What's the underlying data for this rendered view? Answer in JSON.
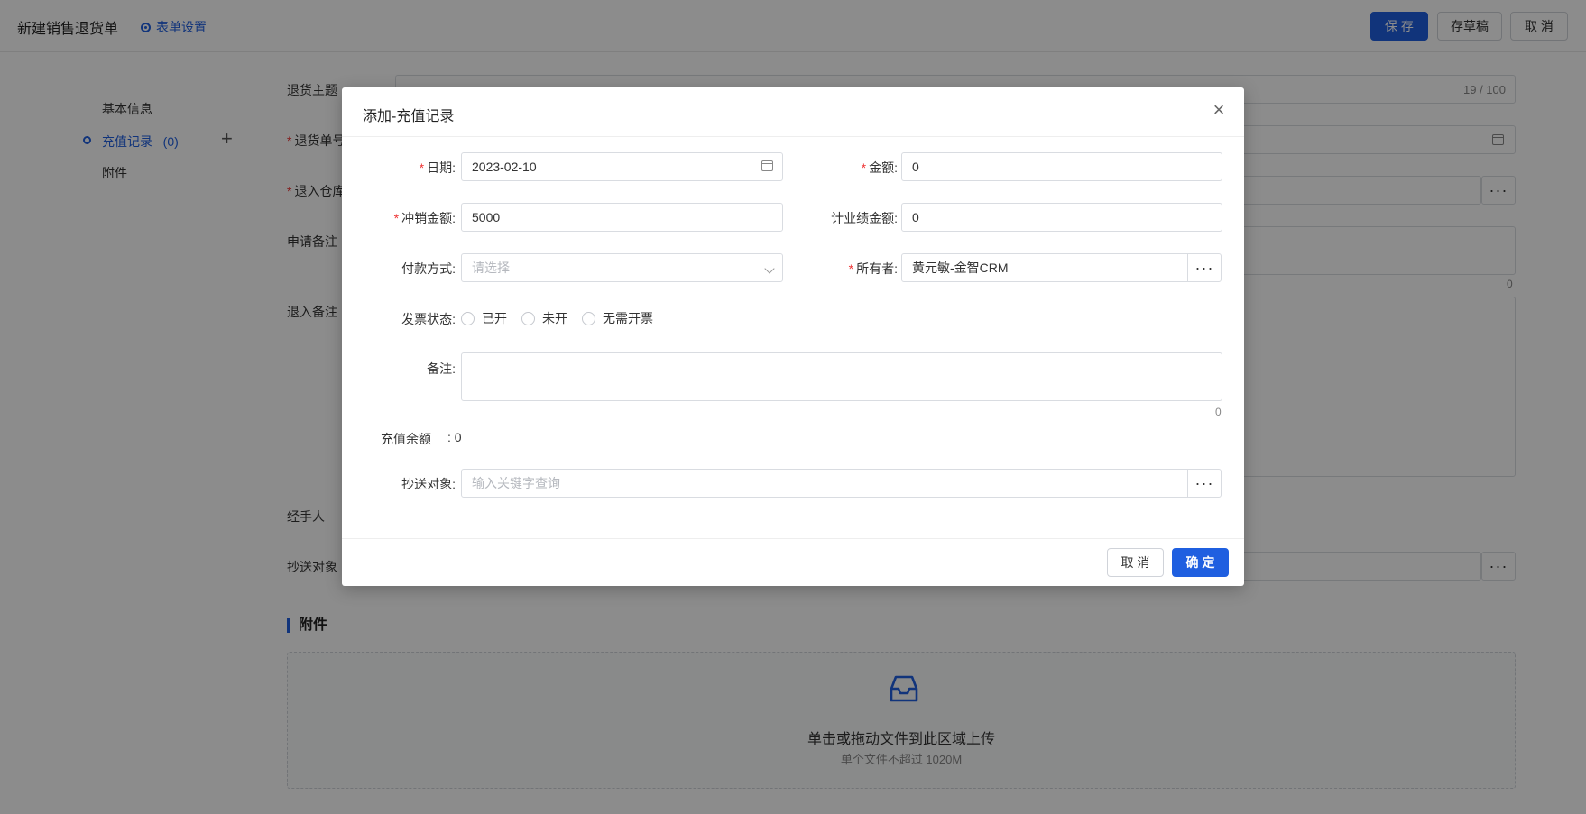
{
  "header": {
    "title": "新建销售退货单",
    "settings_label": "表单设置",
    "save_label": "保 存",
    "draft_label": "存草稿",
    "cancel_label": "取 消"
  },
  "sidebar": {
    "items": [
      {
        "label": "基本信息"
      },
      {
        "label": "充值记录   (0)"
      },
      {
        "label": "附件"
      }
    ]
  },
  "form": {
    "subject_label": "退货主题",
    "subject_counter": "19 / 100",
    "order_no_label": "退货单号",
    "warehouse_label": "退入仓库",
    "apply_note_label": "申请备注",
    "return_note_label": "退入备注",
    "apply_note_counter": "0",
    "handler_label": "经手人",
    "cc_label": "抄送对象",
    "attachment_title": "附件",
    "upload_main": "单击或拖动文件到此区域上传",
    "upload_sub": "单个文件不超过 1020M"
  },
  "modal": {
    "title": "添加-充值记录",
    "date_label": "日期:",
    "date_value": "2023-02-10",
    "amount_label": "金额:",
    "amount_value": "0",
    "writeoff_label": "冲销金额:",
    "writeoff_value": "5000",
    "perf_label": "计业绩金额:",
    "perf_value": "0",
    "payment_label": "付款方式:",
    "payment_placeholder": "请选择",
    "owner_label": "所有者:",
    "owner_value": "黄元敏-金智CRM",
    "invoice_label": "发票状态:",
    "invoice_options": [
      "已开",
      "未开",
      "无需开票"
    ],
    "remark_label": "备注:",
    "remark_counter": "0",
    "balance_label": "充值余额",
    "balance_value": ": 0",
    "cc_label": "抄送对象:",
    "cc_placeholder": "输入关键字查询",
    "cancel_label": "取 消",
    "ok_label": "确 定"
  },
  "colors": {
    "primary": "#1f5fe0",
    "required": "#e33333",
    "overlay": "rgba(0,0,0,0.45)"
  }
}
